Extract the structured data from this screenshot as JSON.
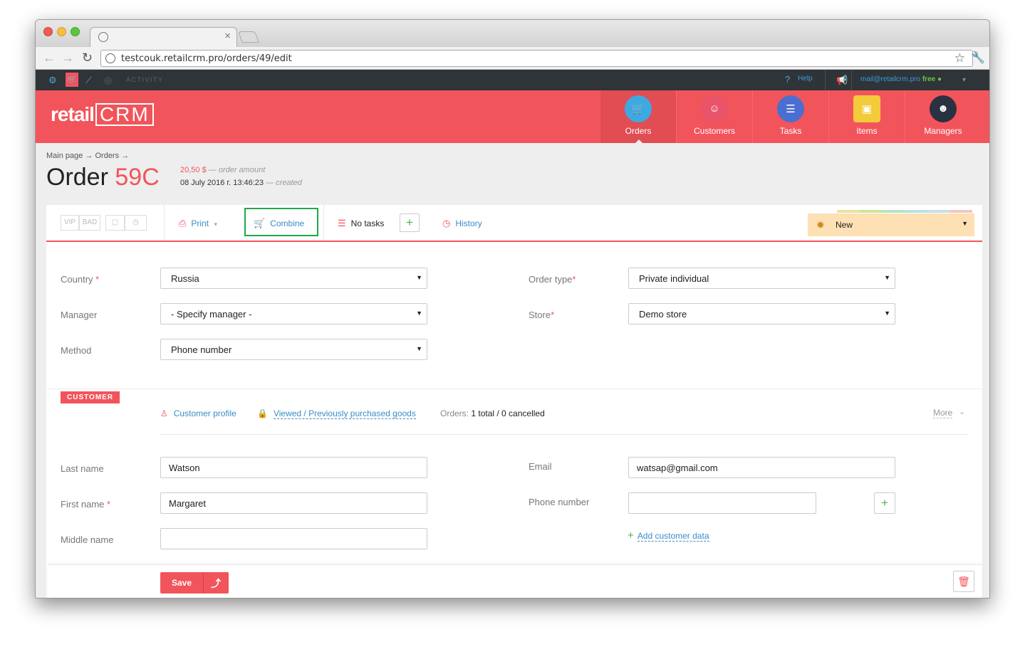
{
  "browser": {
    "tab_close": "×",
    "url": "testcouk.retailcrm.pro/orders/49/edit"
  },
  "topstrip": {
    "activity": "ACTIVITY",
    "help": "Help",
    "email": "mail@retailcrm.pro",
    "plan": "free"
  },
  "header": {
    "logo_text": "retail",
    "logo_crm": "CRM",
    "nav": [
      {
        "label": "Orders",
        "icon": "cart-icon",
        "active": true
      },
      {
        "label": "Customers",
        "icon": "customer-avatar-icon"
      },
      {
        "label": "Tasks",
        "icon": "tasks-list-icon"
      },
      {
        "label": "Items",
        "icon": "box-icon"
      },
      {
        "label": "Managers",
        "icon": "manager-avatar-icon"
      }
    ]
  },
  "page": {
    "breadcrumb": "Main page → Orders →",
    "title_prefix": "Order",
    "order_number": "59C",
    "amount": "20,50 $",
    "amount_note": "— order amount",
    "created_date": "08 July 2016 г. 13:46:23",
    "created_note": "— created"
  },
  "toolbar": {
    "vip": "VIP",
    "bad": "BAD",
    "print": "Print",
    "combine": "Combine",
    "no_tasks": "No tasks",
    "add_task": "+",
    "history": "History",
    "status": "New",
    "status_colors": [
      "#e9e3a0",
      "#cde59a",
      "#b7e3c2",
      "#b9e0e3",
      "#c9dfe6",
      "#f2c6c6"
    ]
  },
  "order_fields": {
    "country_label": "Country",
    "country_value": "Russia",
    "manager_label": "Manager",
    "manager_value": "- Specify manager -",
    "method_label": "Method",
    "method_value": "Phone number",
    "order_type_label": "Order type",
    "order_type_value": "Private individual",
    "store_label": "Store",
    "store_value": "Demo store",
    "required_mark": "*"
  },
  "customer": {
    "badge": "CUSTOMER",
    "profile_link": "Customer profile",
    "viewed_link": "Viewed / Previously purchased goods",
    "orders_label": "Orders:",
    "orders_value": "1 total / 0 cancelled",
    "more": "More",
    "last_name_label": "Last name",
    "last_name_value": "Watson",
    "first_name_label": "First name",
    "first_name_value": "Margaret",
    "middle_name_label": "Middle name",
    "middle_name_value": "",
    "email_label": "Email",
    "email_value": "watsap@gmail.com",
    "phone_label": "Phone number",
    "phone_value": "",
    "add_phone": "+",
    "add_customer_data": "Add customer data"
  },
  "footer": {
    "save": "Save",
    "save_up": "⤴"
  },
  "colors": {
    "brand": "#f2545b",
    "link": "#3a8cc4",
    "highlight_box": "#1fa84a",
    "status_bg": "#fde0b3"
  }
}
